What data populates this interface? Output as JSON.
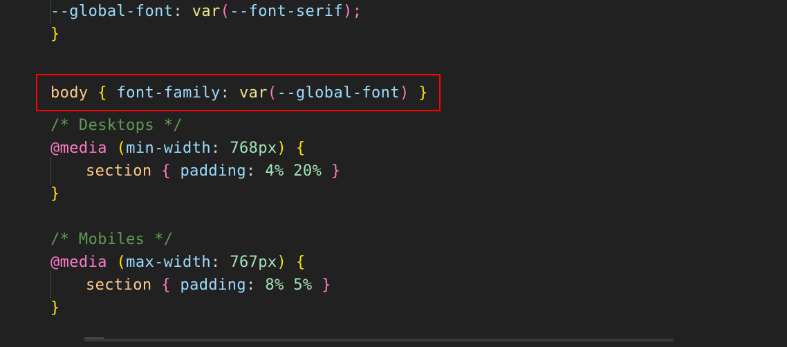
{
  "editor": {
    "background_color": "#212121",
    "highlight_border_color": "#fe0000",
    "font_size_px": 22
  },
  "colors": {
    "property": "#9cdcfe",
    "function": "#f0e68c",
    "paren_pink": "#ff79c6",
    "brace_yellow": "#ffe400",
    "selector": "#ffcb8b",
    "at_rule": "#ff79c6",
    "number": "#a5e3b8",
    "comment": "#5f9b53",
    "default_text": "#d4d4d4"
  },
  "code": {
    "line1": {
      "indent": "    ",
      "prop": "--global-font",
      "colon": ":",
      "func": "var",
      "open_paren": "(",
      "arg": "--font-serif",
      "close_paren": ")",
      "semicolon": ";"
    },
    "line2": {
      "close_brace": "}"
    },
    "highlighted_line": {
      "selector": "body",
      "open_brace": "{",
      "prop": "font-family",
      "colon": ":",
      "func": "var",
      "open_paren": "(",
      "arg": "--global-font",
      "close_paren": ")",
      "close_brace": "}"
    },
    "desktops_block": {
      "comment": "/* Desktops */",
      "at_rule": "@media",
      "open_paren": "(",
      "feature": "min-width",
      "colon": ":",
      "value": "768px",
      "close_paren": ")",
      "open_brace": "{",
      "rule_selector": "section",
      "rule_open_brace": "{",
      "rule_prop": "padding",
      "rule_colon": ":",
      "rule_value": "4% 20%",
      "rule_close_brace": "}",
      "close_brace": "}"
    },
    "mobiles_block": {
      "comment": "/* Mobiles */",
      "at_rule": "@media",
      "open_paren": "(",
      "feature": "max-width",
      "colon": ":",
      "value": "767px",
      "close_paren": ")",
      "open_brace": "{",
      "rule_selector": "section",
      "rule_open_brace": "{",
      "rule_prop": "padding",
      "rule_colon": ":",
      "rule_value": "8% 5%",
      "rule_close_brace": "}",
      "close_brace": "}"
    }
  }
}
